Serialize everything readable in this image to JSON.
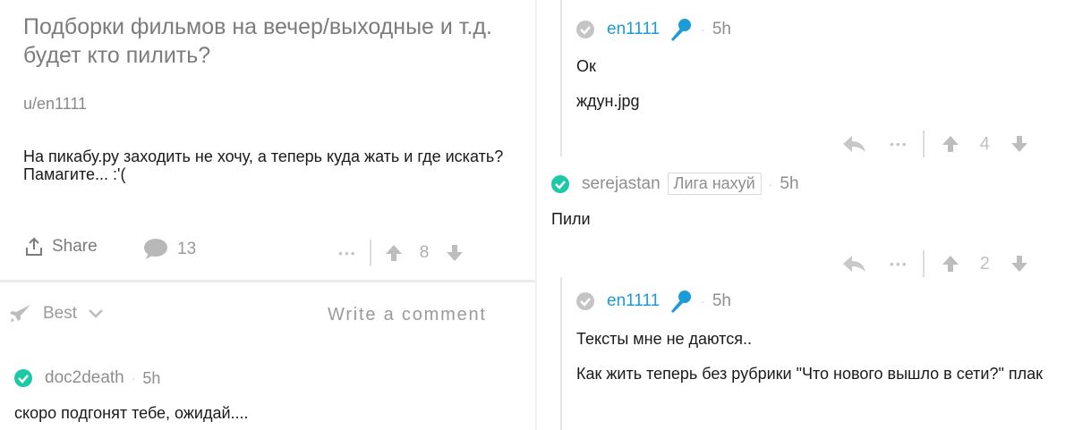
{
  "post": {
    "title": "Подборки фильмов на вечер/выходные и т.д. будет кто пилить?",
    "author": "u/en1111",
    "body": "На пикабу.ру заходить не хочу, а теперь куда жать и где искать? Памагите... :'(",
    "share_label": "Share",
    "comment_count": "13",
    "more_label": "•••",
    "score": "8"
  },
  "sort_bar": {
    "sort_label": "Best",
    "write_comment_label": "Write a comment"
  },
  "comments": [
    {
      "username": "doc2death",
      "time": "5h",
      "text": "скоро подгонят тебе, ожидай...."
    },
    {
      "username": "en1111",
      "time": "5h",
      "lines": [
        "Ок",
        "ждун.jpg"
      ],
      "more_label": "•••",
      "score": "4"
    },
    {
      "username": "serejastan",
      "flair": "Лига нахуй",
      "time": "5h",
      "text": "Пили",
      "more_label": "•••",
      "score": "2"
    },
    {
      "username": "en1111",
      "time": "5h",
      "lines": [
        "Тексты мне не даются..",
        "Как жить теперь без рубрики \"Что нового вышло в сети?\" плак"
      ]
    }
  ],
  "colors": {
    "accent_blue": "#1d9bd8",
    "check_green": "#1cc9a6",
    "muted_gray": "#9a9a9a"
  }
}
